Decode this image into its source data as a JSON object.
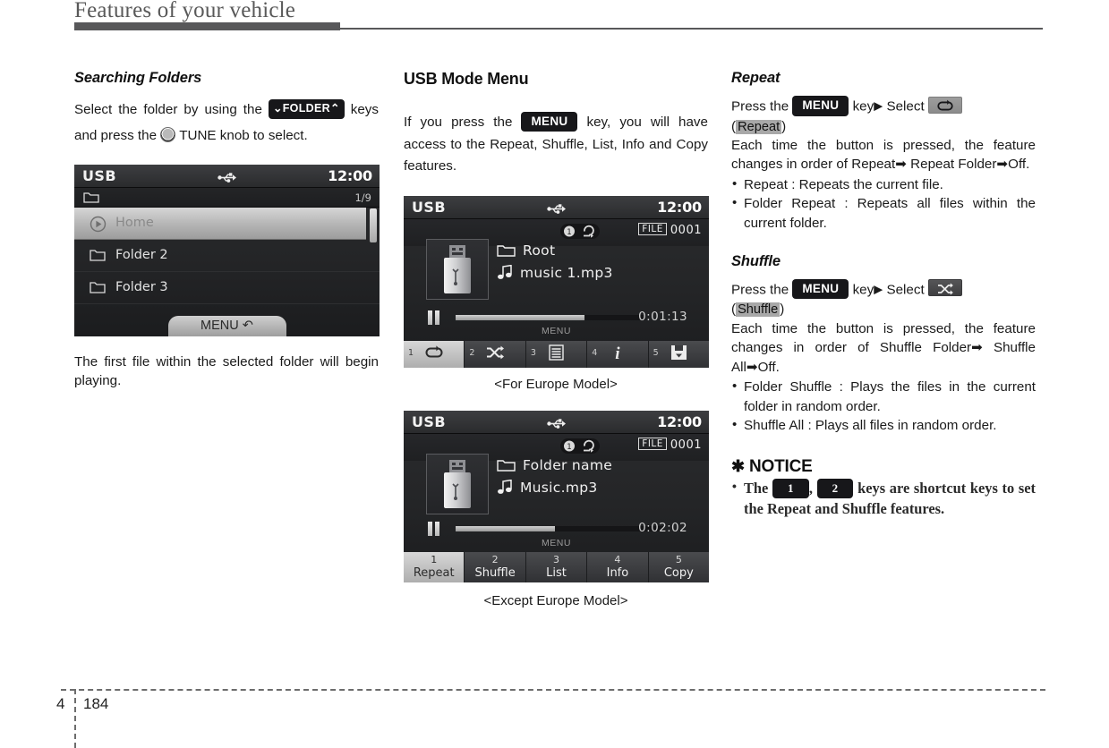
{
  "header": {
    "title": "Features of your vehicle"
  },
  "footer": {
    "chapter": "4",
    "page": "184"
  },
  "left": {
    "heading": "Searching Folders",
    "para_pre": "Select the folder by using the",
    "folder_key": "FOLDER",
    "para_mid": "keys and press the",
    "para_post": "TUNE knob to select.",
    "after_image": "The first file within the selected folder will begin playing.",
    "screen": {
      "source": "USB",
      "clock": "12:00",
      "page_indicator": "1/9",
      "rows": [
        {
          "label": "Home",
          "icon": "play-circle-icon",
          "selected": true
        },
        {
          "label": "Folder 2",
          "icon": "folder-icon",
          "selected": false
        },
        {
          "label": "Folder 3",
          "icon": "folder-icon",
          "selected": false
        }
      ],
      "menu_tab": "MENU"
    }
  },
  "mid": {
    "heading": "USB Mode Menu",
    "para_pre": "If you press the",
    "menu_key": "MENU",
    "para_post": "key, you will have access to the Repeat, Shuffle, List, Info and Copy features.",
    "screen_eu": {
      "source": "USB",
      "clock": "12:00",
      "file_label": "FILE",
      "file_number": "0001",
      "folder": "Root",
      "track": "music 1.mp3",
      "elapsed": "0:01:13",
      "progress_percent": 68,
      "menu_ghost": "MENU",
      "softkeys": [
        {
          "num": "1",
          "icon": "repeat-icon",
          "active": true
        },
        {
          "num": "2",
          "icon": "shuffle-icon",
          "active": false
        },
        {
          "num": "3",
          "icon": "list-icon",
          "active": false
        },
        {
          "num": "4",
          "icon": "info-icon",
          "active": false
        },
        {
          "num": "5",
          "icon": "copy-icon",
          "active": false
        }
      ]
    },
    "caption_eu": "<For Europe Model>",
    "screen_noneu": {
      "source": "USB",
      "clock": "12:00",
      "file_label": "FILE",
      "file_number": "0001",
      "folder": "Folder name",
      "track": "Music.mp3",
      "elapsed": "0:02:02",
      "progress_percent": 48,
      "menu_ghost": "MENU",
      "softkeys": [
        {
          "num": "1",
          "label": "Repeat",
          "active": true
        },
        {
          "num": "2",
          "label": "Shuffle",
          "active": false
        },
        {
          "num": "3",
          "label": "List",
          "active": false
        },
        {
          "num": "4",
          "label": "Info",
          "active": false
        },
        {
          "num": "5",
          "label": "Copy",
          "active": false
        }
      ]
    },
    "caption_noneu": "<Except Europe Model>"
  },
  "right": {
    "repeat": {
      "heading": "Repeat",
      "press_the": "Press the",
      "menu_key": "MENU",
      "key_select": "key",
      "select": "Select",
      "paren_open": "(",
      "highlight": "Repeat",
      "paren_close": ")",
      "desc": "Each time the button is pressed, the feature changes in order of Repeat➡ Repeat Folder➡Off.",
      "bullets": [
        "Repeat : Repeats the current file.",
        "Folder Repeat : Repeats all files within the current folder."
      ]
    },
    "shuffle": {
      "heading": "Shuffle",
      "press_the": "Press the",
      "menu_key": "MENU",
      "key_select": "key",
      "select": "Select",
      "paren_open": "(",
      "highlight": "Shuffle",
      "paren_close": ")",
      "desc": "Each time the button is pressed, the feature changes in order of Shuffle Folder➡ Shuffle All➡Off.",
      "bullets": [
        "Folder Shuffle : Plays the files in the current folder in random order.",
        "Shuffle All : Plays all files in random order."
      ]
    },
    "notice": {
      "star": "✱",
      "title": "NOTICE",
      "text_pre": "The",
      "key1": "1",
      "comma": ",",
      "key2": "2",
      "text_post": "keys are shortcut keys to set the Repeat and Shuffle features."
    }
  }
}
